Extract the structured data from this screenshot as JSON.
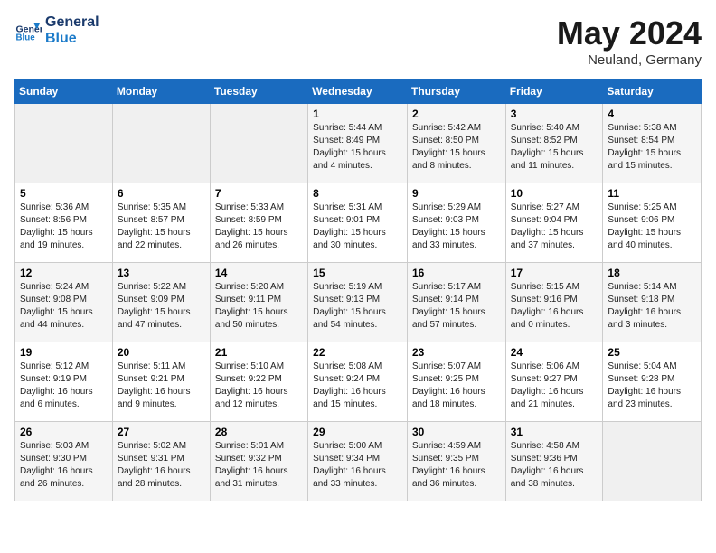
{
  "header": {
    "logo_line1": "General",
    "logo_line2": "Blue",
    "month": "May 2024",
    "location": "Neuland, Germany"
  },
  "weekdays": [
    "Sunday",
    "Monday",
    "Tuesday",
    "Wednesday",
    "Thursday",
    "Friday",
    "Saturday"
  ],
  "weeks": [
    [
      {
        "day": "",
        "info": ""
      },
      {
        "day": "",
        "info": ""
      },
      {
        "day": "",
        "info": ""
      },
      {
        "day": "1",
        "info": "Sunrise: 5:44 AM\nSunset: 8:49 PM\nDaylight: 15 hours\nand 4 minutes."
      },
      {
        "day": "2",
        "info": "Sunrise: 5:42 AM\nSunset: 8:50 PM\nDaylight: 15 hours\nand 8 minutes."
      },
      {
        "day": "3",
        "info": "Sunrise: 5:40 AM\nSunset: 8:52 PM\nDaylight: 15 hours\nand 11 minutes."
      },
      {
        "day": "4",
        "info": "Sunrise: 5:38 AM\nSunset: 8:54 PM\nDaylight: 15 hours\nand 15 minutes."
      }
    ],
    [
      {
        "day": "5",
        "info": "Sunrise: 5:36 AM\nSunset: 8:56 PM\nDaylight: 15 hours\nand 19 minutes."
      },
      {
        "day": "6",
        "info": "Sunrise: 5:35 AM\nSunset: 8:57 PM\nDaylight: 15 hours\nand 22 minutes."
      },
      {
        "day": "7",
        "info": "Sunrise: 5:33 AM\nSunset: 8:59 PM\nDaylight: 15 hours\nand 26 minutes."
      },
      {
        "day": "8",
        "info": "Sunrise: 5:31 AM\nSunset: 9:01 PM\nDaylight: 15 hours\nand 30 minutes."
      },
      {
        "day": "9",
        "info": "Sunrise: 5:29 AM\nSunset: 9:03 PM\nDaylight: 15 hours\nand 33 minutes."
      },
      {
        "day": "10",
        "info": "Sunrise: 5:27 AM\nSunset: 9:04 PM\nDaylight: 15 hours\nand 37 minutes."
      },
      {
        "day": "11",
        "info": "Sunrise: 5:25 AM\nSunset: 9:06 PM\nDaylight: 15 hours\nand 40 minutes."
      }
    ],
    [
      {
        "day": "12",
        "info": "Sunrise: 5:24 AM\nSunset: 9:08 PM\nDaylight: 15 hours\nand 44 minutes."
      },
      {
        "day": "13",
        "info": "Sunrise: 5:22 AM\nSunset: 9:09 PM\nDaylight: 15 hours\nand 47 minutes."
      },
      {
        "day": "14",
        "info": "Sunrise: 5:20 AM\nSunset: 9:11 PM\nDaylight: 15 hours\nand 50 minutes."
      },
      {
        "day": "15",
        "info": "Sunrise: 5:19 AM\nSunset: 9:13 PM\nDaylight: 15 hours\nand 54 minutes."
      },
      {
        "day": "16",
        "info": "Sunrise: 5:17 AM\nSunset: 9:14 PM\nDaylight: 15 hours\nand 57 minutes."
      },
      {
        "day": "17",
        "info": "Sunrise: 5:15 AM\nSunset: 9:16 PM\nDaylight: 16 hours\nand 0 minutes."
      },
      {
        "day": "18",
        "info": "Sunrise: 5:14 AM\nSunset: 9:18 PM\nDaylight: 16 hours\nand 3 minutes."
      }
    ],
    [
      {
        "day": "19",
        "info": "Sunrise: 5:12 AM\nSunset: 9:19 PM\nDaylight: 16 hours\nand 6 minutes."
      },
      {
        "day": "20",
        "info": "Sunrise: 5:11 AM\nSunset: 9:21 PM\nDaylight: 16 hours\nand 9 minutes."
      },
      {
        "day": "21",
        "info": "Sunrise: 5:10 AM\nSunset: 9:22 PM\nDaylight: 16 hours\nand 12 minutes."
      },
      {
        "day": "22",
        "info": "Sunrise: 5:08 AM\nSunset: 9:24 PM\nDaylight: 16 hours\nand 15 minutes."
      },
      {
        "day": "23",
        "info": "Sunrise: 5:07 AM\nSunset: 9:25 PM\nDaylight: 16 hours\nand 18 minutes."
      },
      {
        "day": "24",
        "info": "Sunrise: 5:06 AM\nSunset: 9:27 PM\nDaylight: 16 hours\nand 21 minutes."
      },
      {
        "day": "25",
        "info": "Sunrise: 5:04 AM\nSunset: 9:28 PM\nDaylight: 16 hours\nand 23 minutes."
      }
    ],
    [
      {
        "day": "26",
        "info": "Sunrise: 5:03 AM\nSunset: 9:30 PM\nDaylight: 16 hours\nand 26 minutes."
      },
      {
        "day": "27",
        "info": "Sunrise: 5:02 AM\nSunset: 9:31 PM\nDaylight: 16 hours\nand 28 minutes."
      },
      {
        "day": "28",
        "info": "Sunrise: 5:01 AM\nSunset: 9:32 PM\nDaylight: 16 hours\nand 31 minutes."
      },
      {
        "day": "29",
        "info": "Sunrise: 5:00 AM\nSunset: 9:34 PM\nDaylight: 16 hours\nand 33 minutes."
      },
      {
        "day": "30",
        "info": "Sunrise: 4:59 AM\nSunset: 9:35 PM\nDaylight: 16 hours\nand 36 minutes."
      },
      {
        "day": "31",
        "info": "Sunrise: 4:58 AM\nSunset: 9:36 PM\nDaylight: 16 hours\nand 38 minutes."
      },
      {
        "day": "",
        "info": ""
      }
    ]
  ]
}
